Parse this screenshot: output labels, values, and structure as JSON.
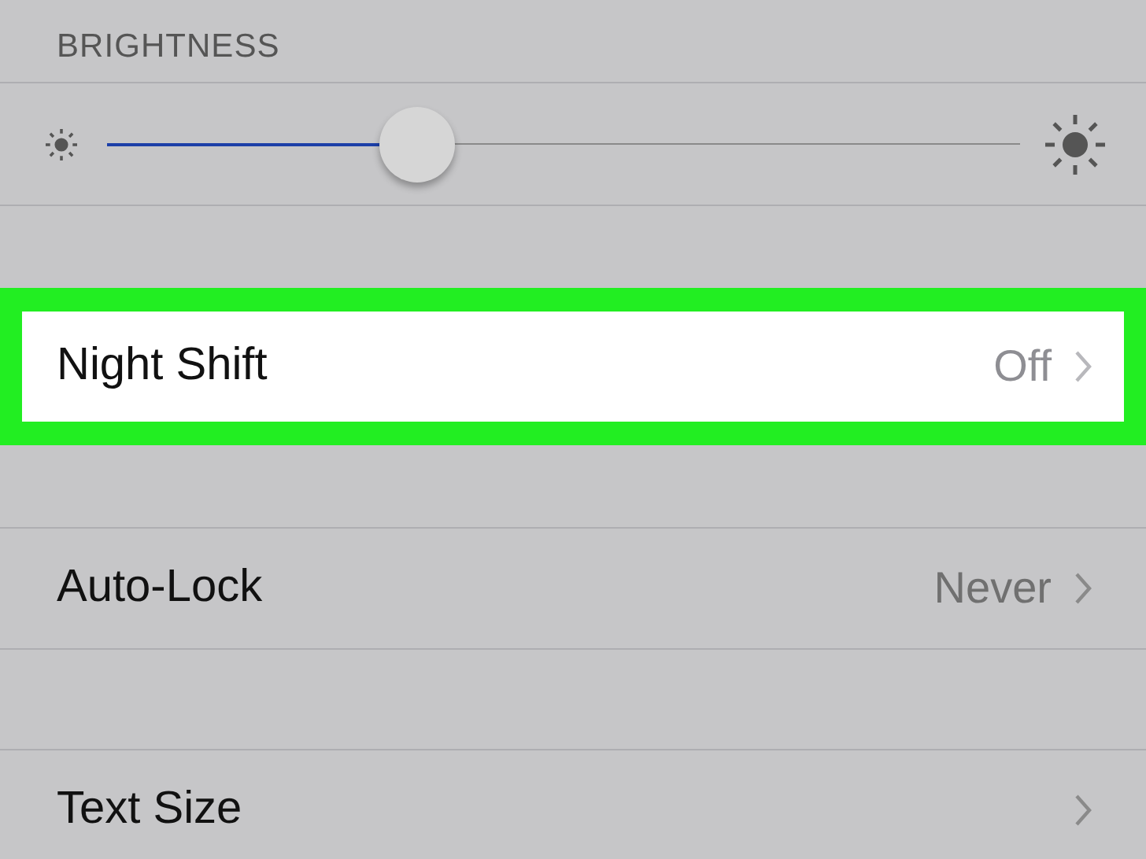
{
  "section_header": "BRIGHTNESS",
  "brightness": {
    "level": 0.34
  },
  "rows": [
    {
      "label": "Night Shift",
      "value": "Off",
      "highlighted": true
    },
    {
      "label": "Auto-Lock",
      "value": "Never",
      "highlighted": false
    },
    {
      "label": "Text Size",
      "highlighted": false
    }
  ]
}
